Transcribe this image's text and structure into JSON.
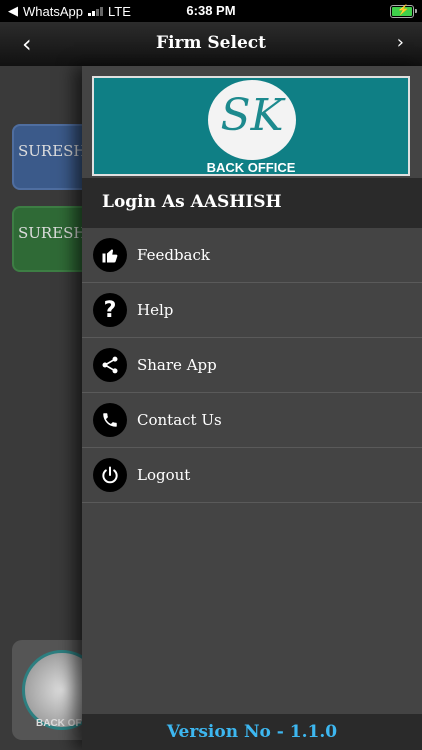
{
  "status_bar": {
    "carrier": "WhatsApp",
    "network": "LTE",
    "time": "6:38 PM"
  },
  "nav": {
    "title": "Firm Select"
  },
  "background": {
    "firms": [
      "SURESH",
      "SURESH"
    ],
    "logo_text": "BACK OFFICE"
  },
  "drawer": {
    "brand": {
      "logo_letters": "SK",
      "subtitle": "BACK OFFICE"
    },
    "login_label": "Login As AASHISH",
    "menu": [
      {
        "label": "Feedback",
        "icon": "thumbs-up-icon"
      },
      {
        "label": "Help",
        "icon": "help-icon"
      },
      {
        "label": "Share App",
        "icon": "share-icon"
      },
      {
        "label": "Contact Us",
        "icon": "phone-icon"
      },
      {
        "label": "Logout",
        "icon": "power-icon"
      }
    ],
    "version": "Version No - 1.1.0"
  },
  "colors": {
    "brand": "#0f7f85",
    "version_text": "#3db7f0"
  }
}
